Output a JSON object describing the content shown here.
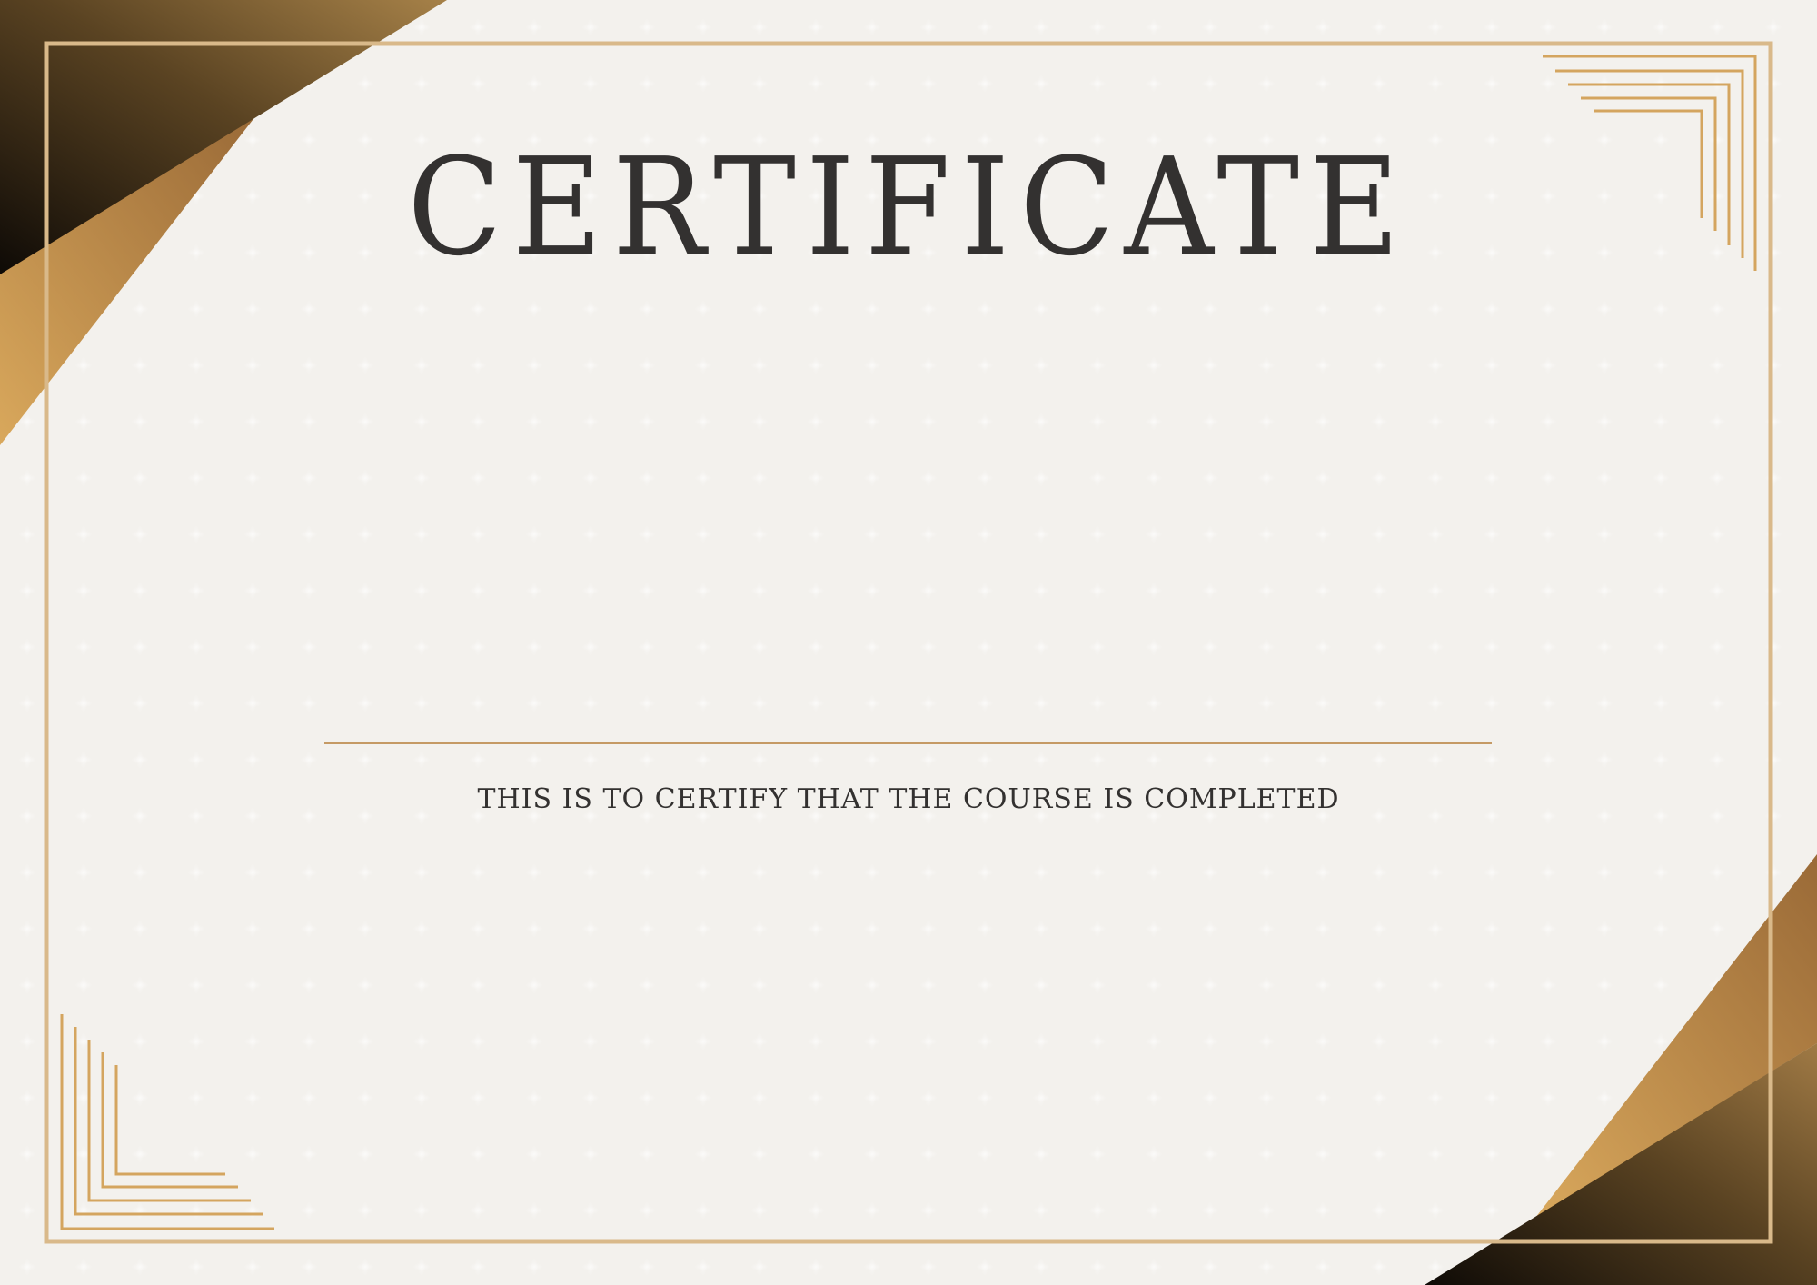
{
  "certificate": {
    "title": "CERTIFICATE",
    "subtitle": "THIS IS TO CERTIFY THAT THE COURSE IS COMPLETED"
  },
  "colors": {
    "background": "#f3f1ed",
    "gold": "#d4a55f",
    "gold_dark": "#a87a44",
    "border": "#d9b98a",
    "ink": "#333130",
    "dark": "#1a130b"
  }
}
